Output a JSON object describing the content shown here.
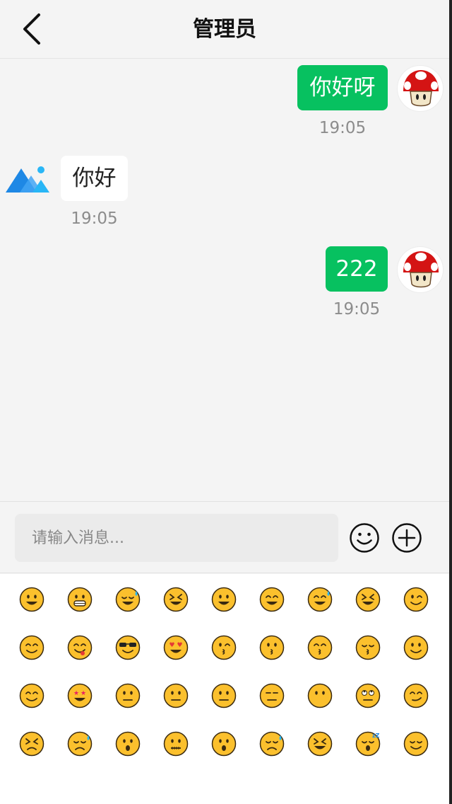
{
  "header": {
    "title": "管理员",
    "back_icon": "chevron-left-icon"
  },
  "messages": [
    {
      "sender": "me",
      "text": "你好呀",
      "time": "19:05",
      "avatar_icon": "mushroom-avatar-icon"
    },
    {
      "sender": "other",
      "text": "你好",
      "time": "19:05",
      "avatar_icon": "mountain-logo-icon"
    },
    {
      "sender": "me",
      "text": "222",
      "time": "19:05",
      "avatar_icon": "mushroom-avatar-icon"
    }
  ],
  "input": {
    "placeholder": "请输入消息...",
    "value": "",
    "emoji_button_icon": "smiley-outline-icon",
    "plus_button_icon": "plus-circle-icon"
  },
  "emojis": [
    [
      "grinning",
      "grimacing",
      "joy",
      "rofl",
      "smiley",
      "smile",
      "sweat-smile",
      "laughing",
      "wink"
    ],
    [
      "blush",
      "yum",
      "sunglasses",
      "heart-eyes",
      "kissing-heart",
      "kissing",
      "kissing-smiling-eyes",
      "kissing-closed-eyes",
      "slightly-smiling"
    ],
    [
      "hugging",
      "star-struck",
      "thinking",
      "raised-eyebrow",
      "neutral",
      "expressionless",
      "no-mouth",
      "rolling-eyes",
      "smirk"
    ],
    [
      "persevere",
      "disappointed-relieved",
      "open-mouth",
      "zipper-mouth",
      "hushed",
      "sleepy",
      "tired",
      "sleeping",
      "relieved"
    ]
  ],
  "colors": {
    "accent": "#07c160",
    "background": "#f4f4f4",
    "emoji_yellow": "#fbc02d",
    "time_text": "#8c8c8c"
  }
}
